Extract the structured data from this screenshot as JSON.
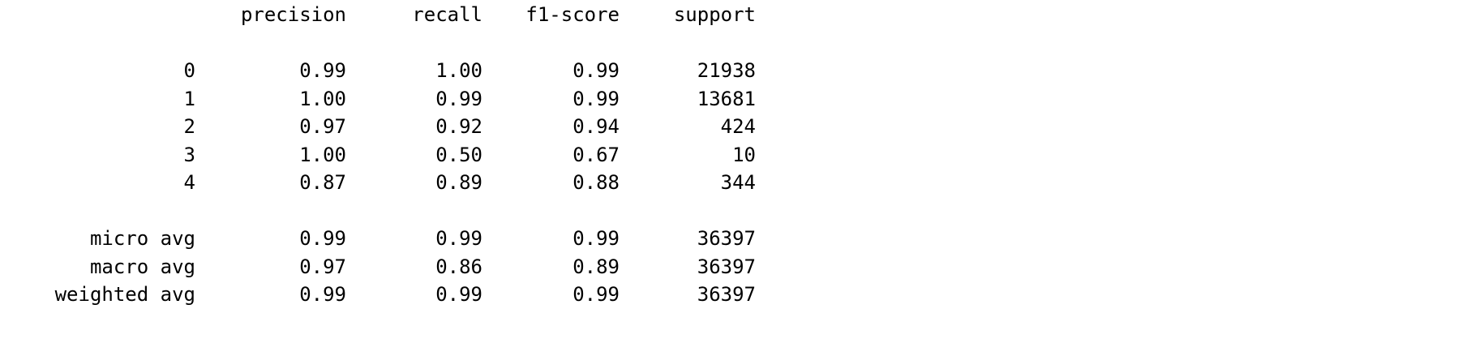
{
  "report": {
    "headers": [
      "precision",
      "recall",
      "f1-score",
      "support"
    ],
    "class_rows": [
      {
        "label": "0",
        "precision": "0.99",
        "recall": "1.00",
        "f1": "0.99",
        "support": "21938"
      },
      {
        "label": "1",
        "precision": "1.00",
        "recall": "0.99",
        "f1": "0.99",
        "support": "13681"
      },
      {
        "label": "2",
        "precision": "0.97",
        "recall": "0.92",
        "f1": "0.94",
        "support": "424"
      },
      {
        "label": "3",
        "precision": "1.00",
        "recall": "0.50",
        "f1": "0.67",
        "support": "10"
      },
      {
        "label": "4",
        "precision": "0.87",
        "recall": "0.89",
        "f1": "0.88",
        "support": "344"
      }
    ],
    "avg_rows": [
      {
        "label": "micro avg",
        "precision": "0.99",
        "recall": "0.99",
        "f1": "0.99",
        "support": "36397"
      },
      {
        "label": "macro avg",
        "precision": "0.97",
        "recall": "0.86",
        "f1": "0.89",
        "support": "36397"
      },
      {
        "label": "weighted avg",
        "precision": "0.99",
        "recall": "0.99",
        "f1": "0.99",
        "support": "36397"
      }
    ]
  }
}
